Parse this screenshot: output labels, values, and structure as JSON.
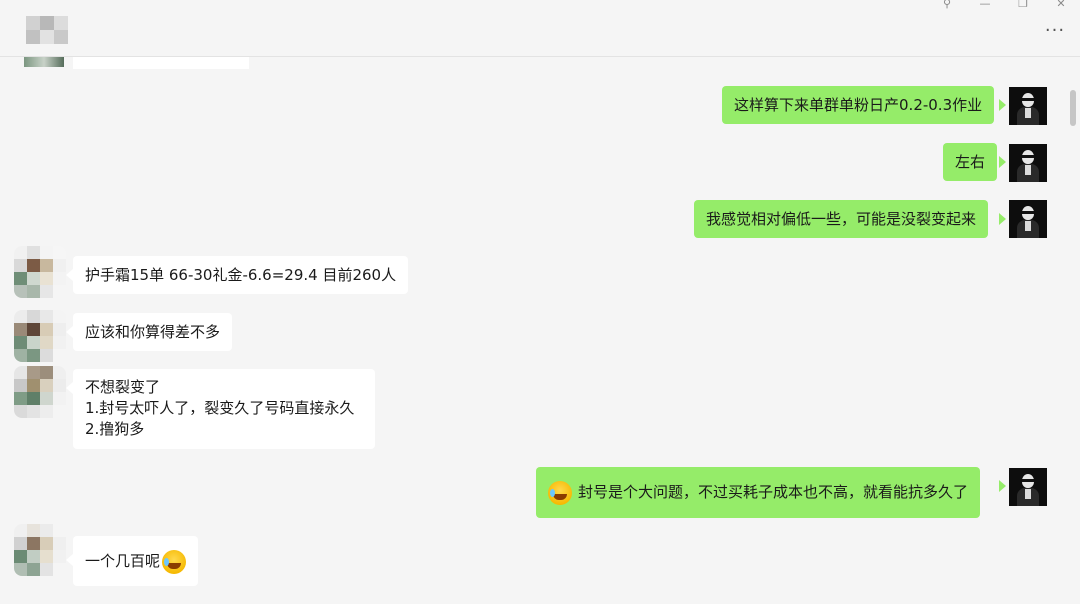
{
  "window": {
    "pin_glyph": "⚲",
    "minimize_glyph": "—",
    "restore_glyph": "❐",
    "close_glyph": "✕",
    "more_glyph": "···"
  },
  "colors": {
    "incoming_bubble": "#ffffff",
    "outgoing_bubble": "#95ec69",
    "background": "#f5f5f5"
  },
  "messages": [
    {
      "side": "out",
      "text": "这样算下来单群单粉日产0.2-0.3作业"
    },
    {
      "side": "out",
      "text": "左右"
    },
    {
      "side": "out",
      "text": "我感觉相对偏低一些，可能是没裂变起来"
    },
    {
      "side": "in",
      "text": "护手霜15单 66-30礼金-6.6=29.4 目前260人"
    },
    {
      "side": "in",
      "text": "应该和你算得差不多"
    },
    {
      "side": "in",
      "lines": [
        "不想裂变了",
        "1.封号太吓人了，裂变久了号码直接永久",
        "2.撸狗多"
      ]
    },
    {
      "side": "out",
      "emoji": "crying-laughing-emoji",
      "text": "封号是个大问题，不过买耗子成本也不高，就看能抗多久了"
    },
    {
      "side": "in",
      "text": "一个几百呢",
      "emoji": "laughing-emoji"
    }
  ]
}
